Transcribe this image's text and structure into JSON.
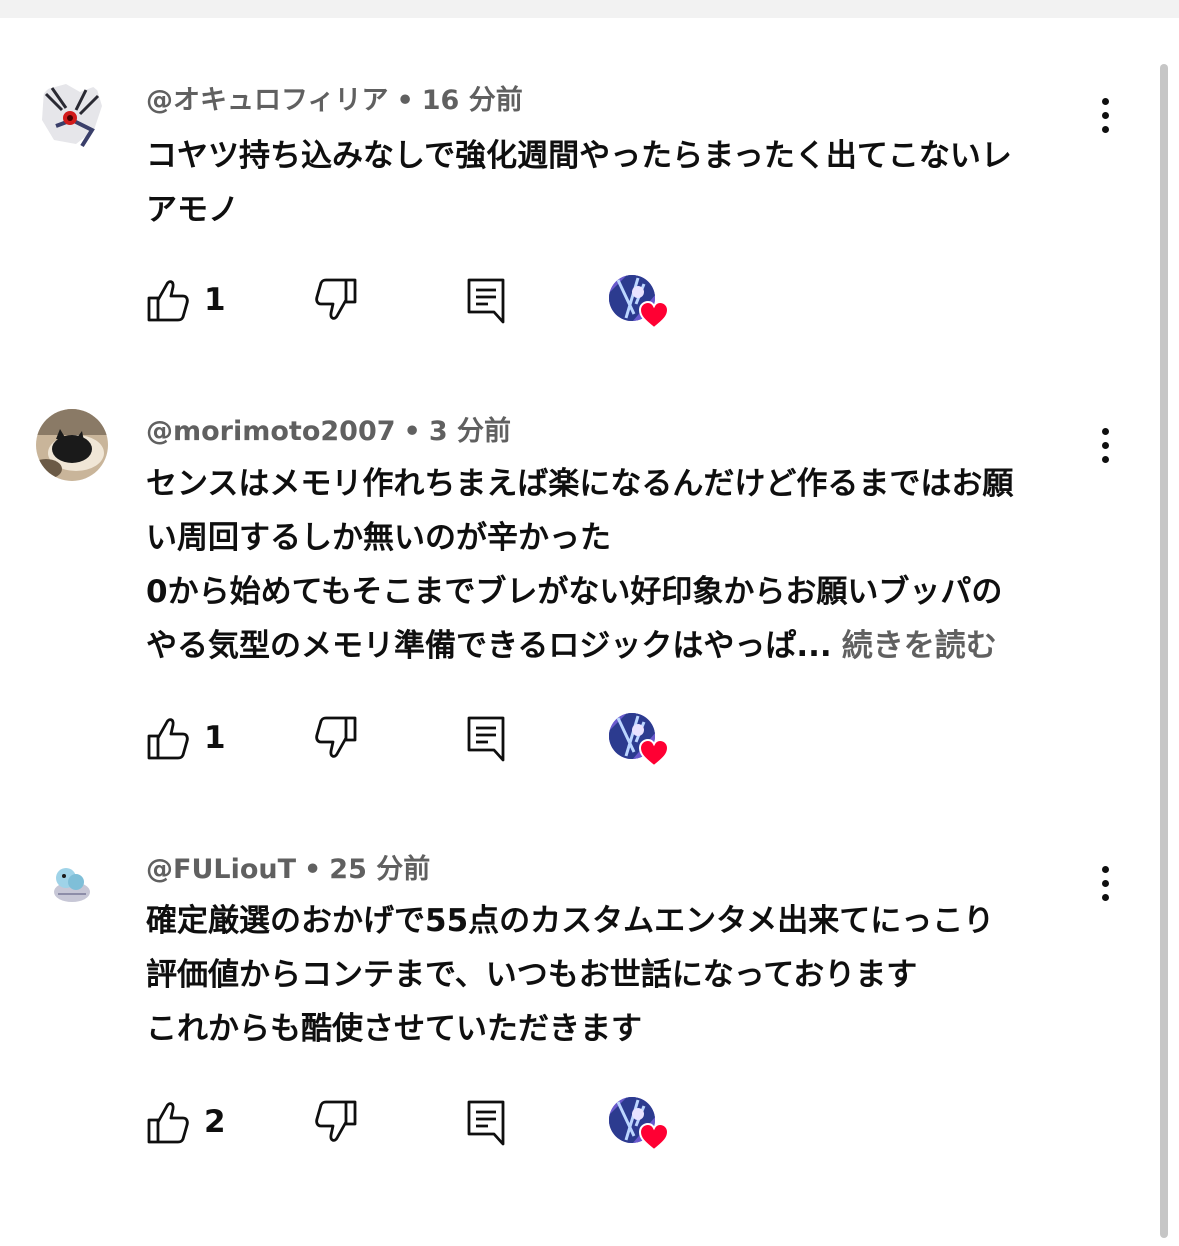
{
  "comments": [
    {
      "author": "@オキュロフィリア",
      "time": "16 分前",
      "lines": [
        "コヤツ持ち込みなしで強化週間やったらまったく出てこないレ",
        "アモノ"
      ],
      "likes": "1",
      "avatar_icon": "anime-character-avatar"
    },
    {
      "author": "@morimoto2007",
      "time": "3 分前",
      "lines": [
        "センスはメモリ作れちまえば楽になるんだけど作るまではお願",
        "い周回するしか無いのが辛かった",
        "0から始めてもそこまでブレがない好印象からお願いブッパの",
        "やる気型のメモリ準備できるロジックはやっぱ..."
      ],
      "read_more": "続きを読む",
      "likes": "1",
      "avatar_icon": "cat-photo-avatar"
    },
    {
      "author": "@FULiouT",
      "time": "25 分前",
      "lines": [
        "確定厳選のおかげで55点のカスタムエンタメ出来てにっこり",
        "評価値からコンテまで、いつもお世話になっております",
        "これからも酷使させていただきます"
      ],
      "likes": "2",
      "avatar_icon": "small-creature-avatar"
    }
  ],
  "colors": {
    "text": "#0f0f0f",
    "meta": "#606060",
    "heart": "#ff0033",
    "topbar": "#f2f2f2",
    "scrollbar": "#c6c6c6"
  },
  "icons": [
    "like-icon",
    "dislike-icon",
    "reply-icon",
    "creator-heart-icon",
    "more-vert-icon"
  ]
}
